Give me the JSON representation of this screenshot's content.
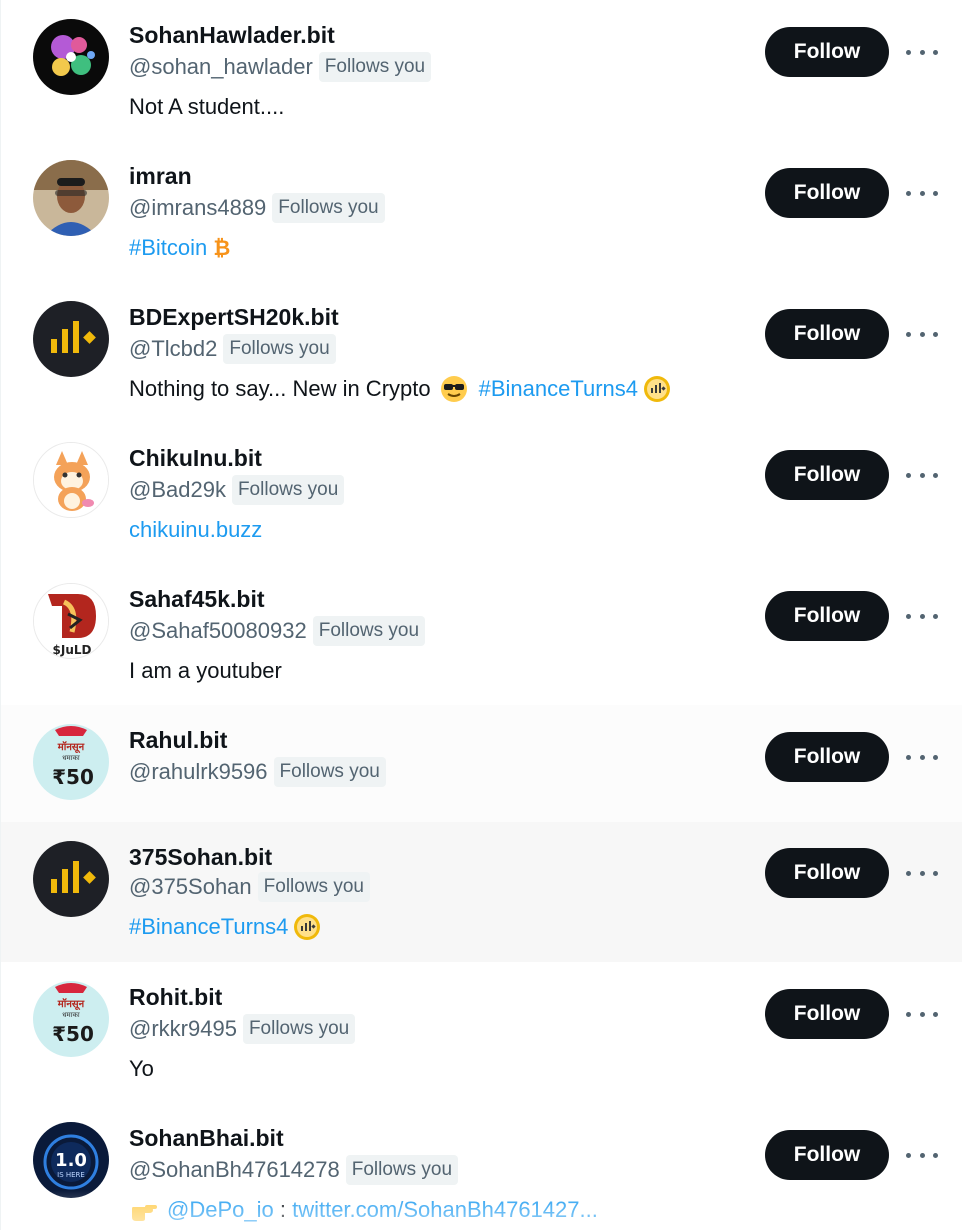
{
  "follow_label": "Follow",
  "follows_you_label": "Follows you",
  "users": [
    {
      "name": "SohanHawlader.bit",
      "handle": "@sohan_hawlader",
      "bio": "Not A student...."
    },
    {
      "name": "imran",
      "handle": "@imrans4889",
      "bio_link": "#Bitcoin",
      "bio_icon": "bitcoin-icon"
    },
    {
      "name": "BDExpertSH20k.bit",
      "handle": "@Tlcbd2",
      "bio": "Nothing to say... New in Crypto",
      "bio_emoji": "sunglasses-emoji-icon",
      "bio_link": "#BinanceTurns4",
      "bio_icon": "binance-hashflag-icon"
    },
    {
      "name": "ChikuInu.bit",
      "handle": "@Bad29k",
      "bio_link": "chikuinu.buzz"
    },
    {
      "name": "Sahaf45k.bit",
      "handle": "@Sahaf50080932",
      "bio": "I am a youtuber",
      "avatar_text": "$JuLD"
    },
    {
      "name": "Rahul.bit",
      "handle": "@rahulrk9596",
      "avatar_text": "₹50"
    },
    {
      "name": "375Sohan.bit",
      "handle": "@375Sohan",
      "bio_link": "#BinanceTurns4",
      "bio_icon": "binance-hashflag-icon"
    },
    {
      "name": "Rohit.bit",
      "handle": "@rkkr9495",
      "bio": "Yo",
      "avatar_text": "₹50"
    },
    {
      "name": "SohanBhai.bit",
      "handle": "@SohanBh47614278",
      "bio_mention": "@DePo_io",
      "bio_sep": " : ",
      "bio_link": "twitter.com/SohanBh4761427...",
      "bio_icon": "pointing-hand-emoji-icon",
      "avatar_text": "1.0",
      "avatar_subtext": "IS HERE"
    }
  ],
  "colors": {
    "link": "#1d9bf0",
    "button_bg": "#0f1419",
    "secondary_text": "#536471",
    "badge_bg": "#eff3f4",
    "hover_bg": "#f7f7f7"
  }
}
